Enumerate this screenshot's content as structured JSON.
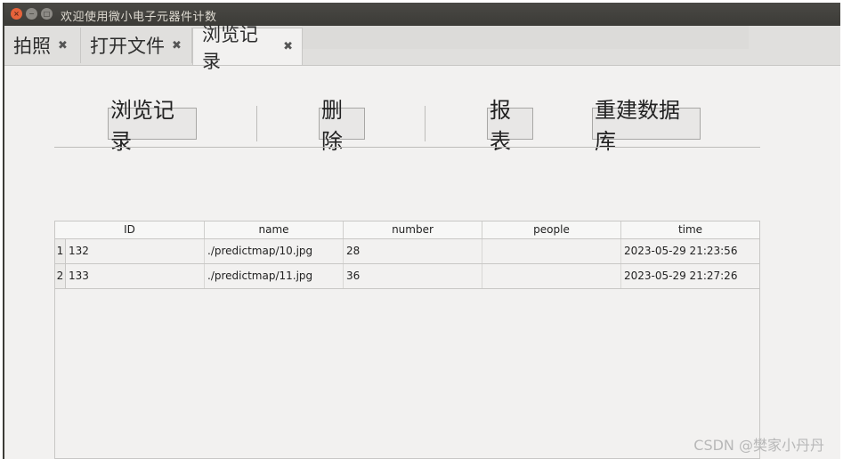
{
  "window": {
    "title": "欢迎使用微小电子元器件计数",
    "close_glyph": "×",
    "min_glyph": "−",
    "max_glyph": "□"
  },
  "tabs": [
    {
      "label": "拍照",
      "close_glyph": "✖"
    },
    {
      "label": "打开文件",
      "close_glyph": "✖"
    },
    {
      "label": "浏览记录",
      "close_glyph": "✖"
    }
  ],
  "active_tab": 2,
  "toolbar": {
    "browse_label": "浏览记录",
    "delete_label": "删除",
    "report_label": "报表",
    "rebuild_label": "重建数据库"
  },
  "table": {
    "columns": [
      "ID",
      "name",
      "number",
      "people",
      "time"
    ],
    "rows": [
      {
        "index": "1",
        "id": "132",
        "name": "./predictmap/10.jpg",
        "number": "28",
        "people": "",
        "time": "2023-05-29 21:23:56"
      },
      {
        "index": "2",
        "id": "133",
        "name": "./predictmap/11.jpg",
        "number": "36",
        "people": "",
        "time": "2023-05-29 21:27:26"
      }
    ]
  },
  "watermark": "CSDN @樊家小丹丹",
  "colors": {
    "titlebar": "#3c3b37",
    "close_button": "#e6623a",
    "window_bg": "#f2f1f0"
  }
}
